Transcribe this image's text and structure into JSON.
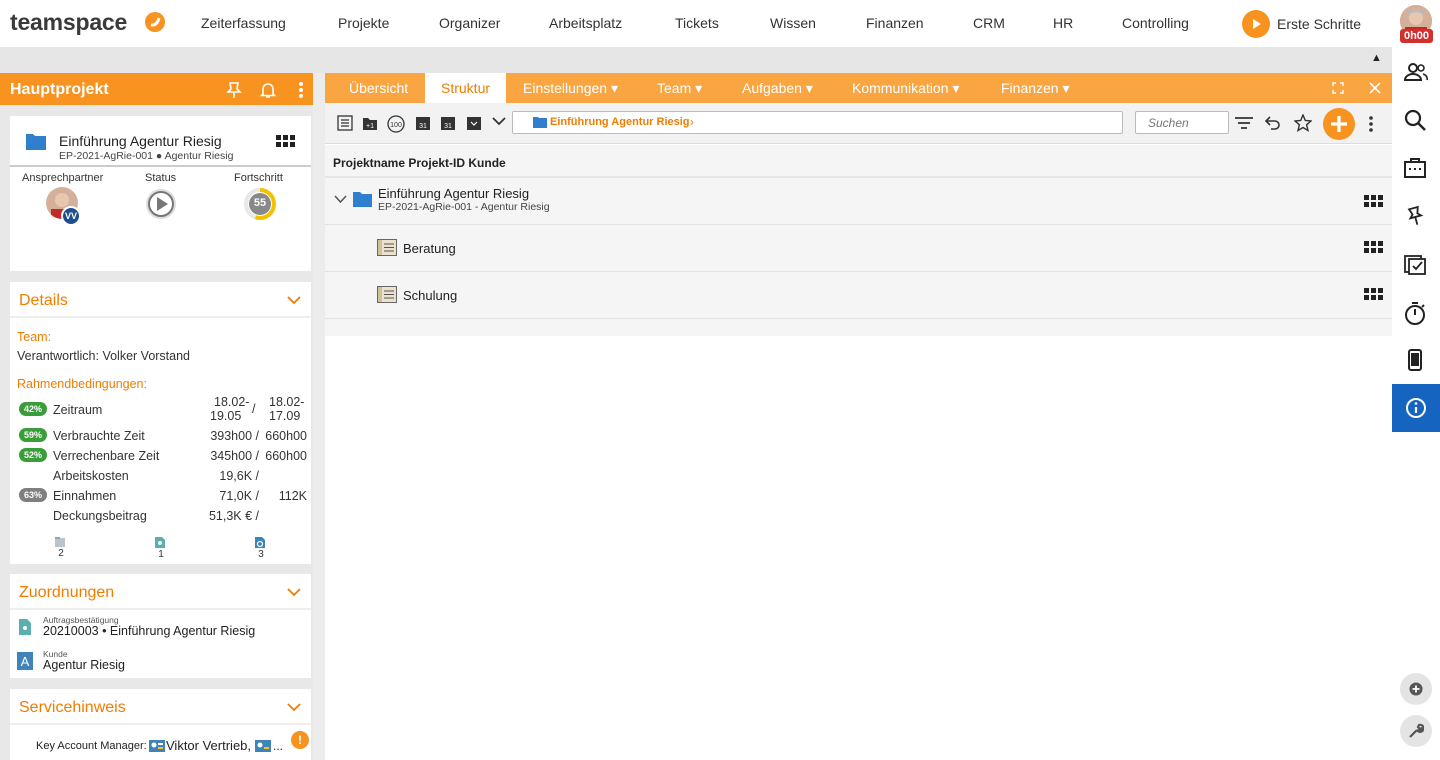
{
  "brand": {
    "name": "teamspace",
    "accent": "#f7931e"
  },
  "topnav": {
    "items": [
      "Zeiterfassung",
      "Projekte",
      "Organizer",
      "Arbeitsplatz",
      "Tickets",
      "Wissen",
      "Finanzen",
      "CRM",
      "HR",
      "Controlling"
    ],
    "erste_schritte": "Erste Schritte",
    "timer": "0h00"
  },
  "left": {
    "header_title": "Hauptprojekt",
    "project": {
      "name": "Einführung Agentur Riesig",
      "sub": "EP-2021-AgRie-001 ● Agentur Riesig",
      "col_contact": "Ansprechpartner",
      "col_status": "Status",
      "col_progress": "Fortschritt",
      "contact_initials": "VV",
      "progress_value": "55",
      "progress_fraction": 0.55
    },
    "details": {
      "title": "Details",
      "team_label": "Team:",
      "responsible": "Verantwortlich: Volker Vorstand",
      "conditions_label": "Rahmendbedingungen:",
      "rows": [
        {
          "pct": "42%",
          "pct_color": "green",
          "label": "Zeitraum",
          "v1a": "18.02-",
          "v1b": "19.05",
          "sep": "/",
          "v2a": "18.02-",
          "v2b": "17.09"
        },
        {
          "pct": "59%",
          "pct_color": "green",
          "label": "Verbrauchte Zeit",
          "v1": "393h00 /",
          "v2": "660h00"
        },
        {
          "pct": "52%",
          "pct_color": "green",
          "label": "Verrechenbare Zeit",
          "v1": "345h00 /",
          "v2": "660h00"
        },
        {
          "pct": "",
          "label": "Arbeitskosten",
          "v1": "19,6K /",
          "v2": ""
        },
        {
          "pct": "63%",
          "pct_color": "gray",
          "label": "Einnahmen",
          "v1": "71,0K /",
          "v2": "112K"
        },
        {
          "pct": "",
          "label": "Deckungsbeitrag",
          "v1": "51,3K € /",
          "v2": ""
        }
      ],
      "counts": [
        "2",
        "1",
        "3"
      ]
    },
    "assignments": {
      "title": "Zuordnungen",
      "items": [
        {
          "caption": "Auftragsbestätigung",
          "value": "20210003 • Einführung Agentur Riesig"
        },
        {
          "caption": "Kunde",
          "value": "Agentur Riesig"
        }
      ]
    },
    "service": {
      "title": "Servicehinweis",
      "line_label": "Key Account Manager:",
      "line_value": "Viktor Vertrieb,",
      "line_more": "..."
    }
  },
  "tabs": [
    "Übersicht",
    "Struktur",
    "Einstellungen ▾",
    "Team ▾",
    "Aufgaben ▾",
    "Kommunikation ▾",
    "Finanzen ▾"
  ],
  "active_tab": "Struktur",
  "toolbar": {
    "breadcrumb": "Einführung Agentur Riesig",
    "search_placeholder": "Suchen"
  },
  "table": {
    "header": "Projektname Projekt-ID Kunde",
    "root": {
      "name": "Einführung Agentur Riesig",
      "sub": "EP-2021-AgRie-001 - Agentur Riesig"
    },
    "children": [
      "Beratung",
      "Schulung"
    ]
  }
}
